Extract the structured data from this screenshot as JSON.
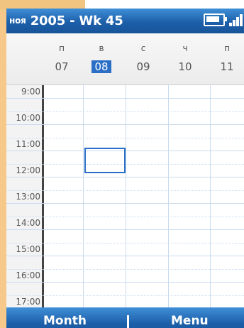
{
  "title": {
    "month": "ноя",
    "rest": "2005 - Wk 45"
  },
  "status": {
    "battery": "battery-icon",
    "signal": "signal-icon"
  },
  "days": [
    {
      "letter": "п",
      "num": "07"
    },
    {
      "letter": "в",
      "num": "08",
      "selected": true
    },
    {
      "letter": "с",
      "num": "09"
    },
    {
      "letter": "ч",
      "num": "10"
    },
    {
      "letter": "п",
      "num": "11"
    }
  ],
  "times": [
    "9:00",
    "10:00",
    "11:00",
    "12:00",
    "13:00",
    "14:00",
    "15:00",
    "16:00",
    "17:00"
  ],
  "softkeys": {
    "left": "Month",
    "right": "Menu"
  },
  "colors": {
    "accent": "#2a6fc5",
    "grid": "#c9dbef",
    "frame": "#f6c98a"
  }
}
